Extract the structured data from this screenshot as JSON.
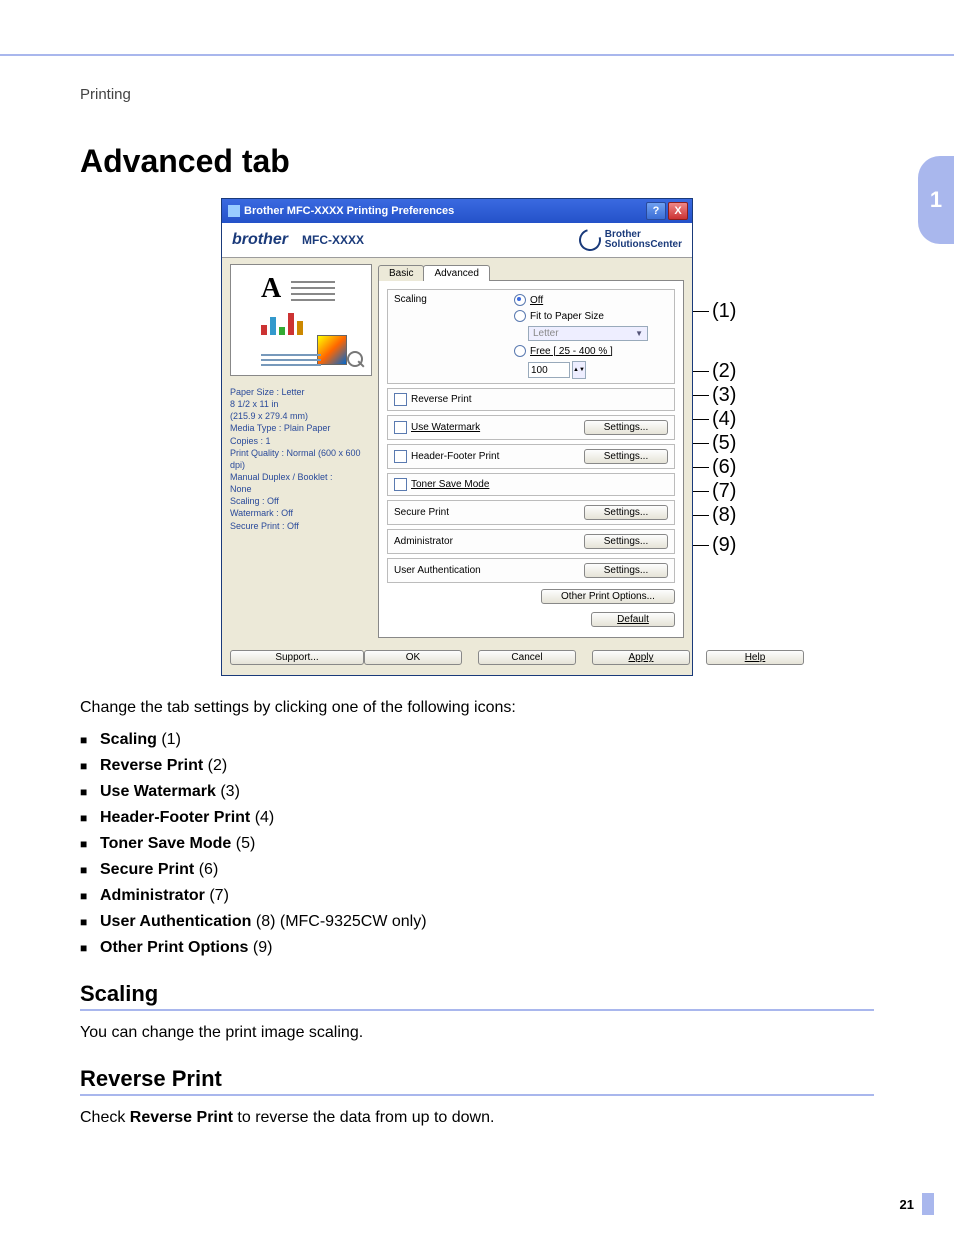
{
  "chapter_number": "1",
  "section_label": "Printing",
  "page_title": "Advanced tab",
  "dialog": {
    "title": "Brother MFC-XXXX Printing Preferences",
    "help_symbol": "?",
    "close_symbol": "X",
    "brand_logo": "brother",
    "model": "MFC-XXXX",
    "solutions": "Brother\nSolutionsCenter",
    "tabs": {
      "basic": "Basic",
      "advanced": "Advanced"
    },
    "summary": {
      "l1": "Paper Size : Letter",
      "l2": "8 1/2 x 11 in",
      "l3": "(215.9 x 279.4 mm)",
      "l4": "Media Type : Plain Paper",
      "l5": "Copies : 1",
      "l6": "Print Quality : Normal (600 x 600 dpi)",
      "l7": "Manual Duplex / Booklet :",
      "l8": "None",
      "l9": "Scaling : Off",
      "l10": "Watermark : Off",
      "l11": "Secure Print : Off"
    },
    "scaling": {
      "label": "Scaling",
      "off": "Off",
      "fit": "Fit to Paper Size",
      "fit_value": "Letter",
      "free": "Free [ 25 - 400 % ]",
      "free_value": "100"
    },
    "rows": {
      "reverse": "Reverse Print",
      "watermark": "Use Watermark",
      "header_footer": "Header-Footer Print",
      "toner_save": "Toner Save Mode",
      "secure": "Secure Print",
      "admin": "Administrator",
      "user_auth": "User Authentication"
    },
    "settings_btn": "Settings...",
    "other_btn": "Other Print Options...",
    "default_btn": "Default",
    "support_btn": "Support...",
    "footer": {
      "ok": "OK",
      "cancel": "Cancel",
      "apply": "Apply",
      "help": "Help"
    }
  },
  "callouts": {
    "c1": "(1)",
    "c2": "(2)",
    "c3": "(3)",
    "c4": "(4)",
    "c5": "(5)",
    "c6": "(6)",
    "c7": "(7)",
    "c8": "(8)",
    "c9": "(9)"
  },
  "intro_text": "Change the tab settings by clicking one of the following icons:",
  "list": {
    "i1b": "Scaling",
    "i1n": " (1)",
    "i2b": "Reverse Print",
    "i2n": " (2)",
    "i3b": "Use Watermark",
    "i3n": " (3)",
    "i4b": "Header-Footer Print",
    "i4n": " (4)",
    "i5b": "Toner Save Mode",
    "i5n": " (5)",
    "i6b": "Secure Print",
    "i6n": " (6)",
    "i7b": "Administrator",
    "i7n": " (7)",
    "i8b": "User Authentication",
    "i8n": " (8) (MFC-9325CW only)",
    "i9b": "Other Print Options",
    "i9n": " (9)"
  },
  "scaling_section": {
    "heading": "Scaling",
    "text": "You can change the print image scaling."
  },
  "reverse_section": {
    "heading": "Reverse Print",
    "pre": "Check ",
    "bold": "Reverse Print",
    "post": " to reverse the data from up to down."
  },
  "page_number": "21"
}
